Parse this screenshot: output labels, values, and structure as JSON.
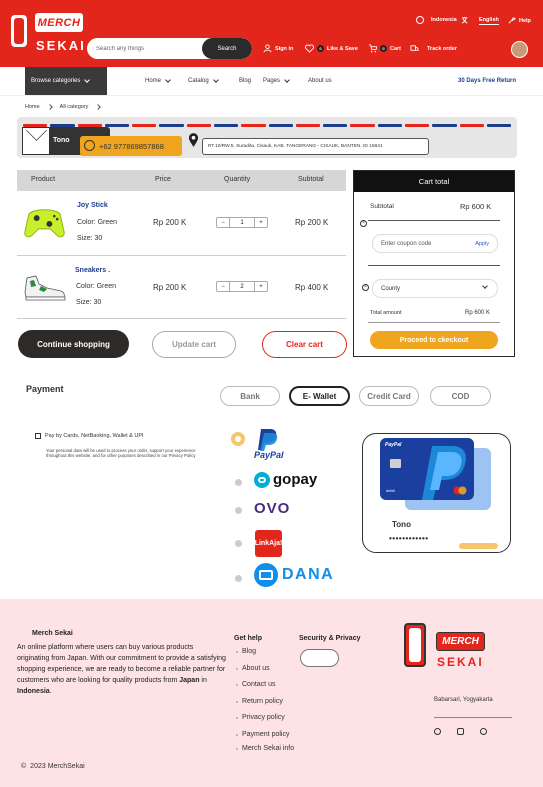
{
  "header": {
    "logo_top": "MERCH",
    "logo_bottom": "SEKAI",
    "search_placeholder": "Search any things",
    "search_button": "Search",
    "country": "Indonesia",
    "language": "English",
    "help": "Help",
    "signin": "Sign in",
    "like_count": "0",
    "like_label": "Like & Save",
    "cart_count": "0",
    "cart_label": "Cart",
    "track_label": "Track order"
  },
  "nav": {
    "browse": "Browse categories",
    "items": [
      "Home",
      "Catalog",
      "Blog",
      "Pages",
      "About us"
    ],
    "promo": "30 Days Free Return"
  },
  "breadcrumb": [
    "Home",
    "All category"
  ],
  "address": {
    "name": "Tono",
    "phone": "+62 977869857868",
    "address": "RT.10/RW.5, Suradita, Cisauk, KAB. TANGERANG - CISAUK, BANTEN, ID 15841"
  },
  "cart": {
    "columns": [
      "Product",
      "Price",
      "Quantity",
      "Subtotal"
    ],
    "rows": [
      {
        "name": "Joy Stick",
        "color": "Color: Green",
        "size": "Size: 30",
        "price": "Rp 200 K",
        "qty": "1",
        "subtotal": "Rp 200 K"
      },
      {
        "name": "Sneakers .",
        "color": "Color: Green",
        "size": "Size: 30",
        "price": "Rp 200 K",
        "qty": "2",
        "subtotal": "Rp 400 K"
      }
    ],
    "continue": "Continue shopping",
    "update": "Update cart",
    "clear": "Clear cart"
  },
  "cart_total": {
    "title": "Cart total",
    "subtotal_label": "Subtotal",
    "subtotal_value": "Rp 600 K",
    "coupon_placeholder": "Enter coupon code",
    "apply": "Apply",
    "county": "County",
    "total_label": "Total amount",
    "total_value": "Rp 600 K",
    "checkout": "Proceed to ckeckout"
  },
  "payment": {
    "title": "Payment",
    "tabs": [
      "Bank",
      "E- Wallet",
      "Credit Card",
      "COD"
    ],
    "active_tab": "E- Wallet",
    "checkbox_label": "Pay by Cards, NetBanking, Wallet & UPI",
    "note": "Your personal data will be used to process your order, support your experience throughout this website, and for other purposes described in our Privacy Policy",
    "wallets": [
      "PayPal",
      "gopay",
      "OVO",
      "LinkAja!",
      "DANA"
    ],
    "card": {
      "brand": "PayPal",
      "holder": "Tono",
      "number": "••••••••••••",
      "type": "debit"
    }
  },
  "footer": {
    "brand": "Merch Sekai",
    "desc_pre": "An online platform where users can buy various products originating from Japan. With our commitment to provide a satisfying shopping experience, we are ready to become a reliable partner for customers who are looking for quality products from ",
    "desc_bold1": "Japan",
    "desc_mid": " in ",
    "desc_bold2": "Indonesia",
    "desc_end": ".",
    "gethelp": "Get help",
    "links": [
      "Blog",
      "About us",
      "Contact us",
      "Return policy",
      "Privacy policy",
      "Payment policy",
      "Merch Sekai info"
    ],
    "security": "Security & Privacy",
    "logo_top": "MERCH",
    "logo_bottom": "SEKAI",
    "location": "Babarsari, Yogyakarta",
    "copyright": "2023 MerchSekai"
  },
  "colors": {
    "brand_red": "#e3261c",
    "accent_orange": "#f0a51e",
    "dark": "#2e2a27",
    "footer_bg": "#fde3e5",
    "navy": "#1e3c8c"
  }
}
